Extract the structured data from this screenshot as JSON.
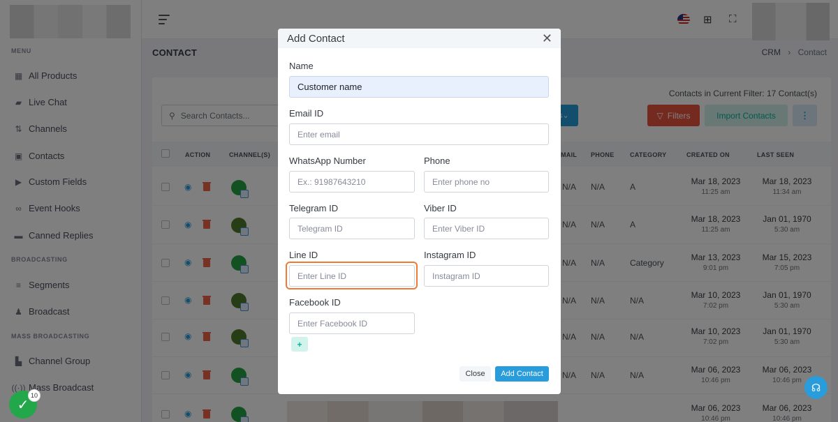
{
  "sidebar": {
    "sections": [
      "MENU",
      "BROADCASTING",
      "MASS BROADCASTING"
    ],
    "menu_items": [
      {
        "label": "All Products",
        "icon": "grid-icon"
      },
      {
        "label": "Live Chat",
        "icon": "chat-icon"
      },
      {
        "label": "Channels",
        "icon": "channels-icon"
      },
      {
        "label": "Contacts",
        "icon": "contact-card-icon"
      },
      {
        "label": "Custom Fields",
        "icon": "tag-icon"
      },
      {
        "label": "Event Hooks",
        "icon": "link-icon"
      },
      {
        "label": "Canned Replies",
        "icon": "message-icon"
      }
    ],
    "broadcasting_items": [
      {
        "label": "Segments",
        "icon": "filter-lines-icon"
      },
      {
        "label": "Broadcast",
        "icon": "broadcast-icon"
      }
    ],
    "mass_items": [
      {
        "label": "Channel Group",
        "icon": "group-icon"
      },
      {
        "label": "Mass Broadcast",
        "icon": "broadcast-icon"
      }
    ]
  },
  "page": {
    "title": "CONTACT",
    "breadcrumb": {
      "root": "CRM",
      "separator": "›",
      "current": "Contact"
    },
    "contacts_count": "Contacts in Current Filter: 17 Contact(s)",
    "search_placeholder": "Search Contacts...",
    "filters_label": "Filters",
    "import_label": "Import Contacts",
    "more_label": "⋮",
    "partial_button_label": "s",
    "columns": [
      "ACTION",
      "CHANNEL(S)",
      "MAIL",
      "PHONE",
      "CATEGORY",
      "CREATED ON",
      "LAST SEEN"
    ],
    "rows": [
      {
        "mail": "N/A",
        "phone": "N/A",
        "category": "A",
        "created": "Mar 18, 2023",
        "created_time": "11:25 am",
        "seen": "Mar 18, 2023",
        "seen_time": "11:34 am"
      },
      {
        "mail": "N/A",
        "phone": "N/A",
        "category": "A",
        "created": "Mar 18, 2023",
        "created_time": "11:25 am",
        "seen": "Jan 01, 1970",
        "seen_time": "5:30 am"
      },
      {
        "mail": "N/A",
        "phone": "N/A",
        "category": "Category",
        "created": "Mar 13, 2023",
        "created_time": "9:01 pm",
        "seen": "Mar 15, 2023",
        "seen_time": "7:05 pm"
      },
      {
        "mail": "N/A",
        "phone": "N/A",
        "category": "N/A",
        "created": "Mar 10, 2023",
        "created_time": "7:02 pm",
        "seen": "Jan 01, 1970",
        "seen_time": "5:30 am"
      },
      {
        "mail": "N/A",
        "phone": "N/A",
        "category": "N/A",
        "created": "Mar 10, 2023",
        "created_time": "7:02 pm",
        "seen": "Jan 01, 1970",
        "seen_time": "5:30 am"
      },
      {
        "mail": "N/A",
        "phone": "N/A",
        "category": "N/A",
        "created": "Mar 06, 2023",
        "created_time": "10:46 pm",
        "seen": "Mar 06, 2023",
        "seen_time": "10:46 pm"
      },
      {
        "mail": "",
        "phone": "",
        "category": "",
        "created": "Mar 06, 2023",
        "created_time": "10:46 pm",
        "seen": "Mar 06, 2023",
        "seen_time": "10:46 pm"
      }
    ]
  },
  "modal": {
    "title": "Add Contact",
    "name_label": "Name",
    "name_value": "Customer name",
    "email_label": "Email ID",
    "email_placeholder": "Enter email",
    "whatsapp_label": "WhatsApp Number",
    "whatsapp_placeholder": "Ex.: 91987643210",
    "phone_label": "Phone",
    "phone_placeholder": "Enter phone no",
    "telegram_label": "Telegram ID",
    "telegram_placeholder": "Telegram ID",
    "viber_label": "Viber ID",
    "viber_placeholder": "Enter Viber ID",
    "line_label": "Line ID",
    "line_placeholder": "Enter Line ID",
    "instagram_label": "Instagram ID",
    "instagram_placeholder": "Instagram ID",
    "facebook_label": "Facebook ID",
    "facebook_placeholder": "Enter Facebook ID",
    "add_field_label": "+",
    "close_label": "Close",
    "submit_label": "Add Contact"
  },
  "notification_badge": "10",
  "colors": {
    "primary": "#299cdb",
    "danger": "#e8553e",
    "success": "#0ab39c",
    "focus": "#f07a33"
  }
}
